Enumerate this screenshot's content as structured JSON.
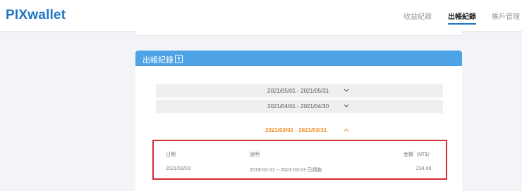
{
  "app": {
    "logo": "PIXwallet"
  },
  "nav": {
    "items": [
      {
        "label": "收益紀錄",
        "active": false
      },
      {
        "label": "出帳紀錄",
        "active": true
      },
      {
        "label": "帳戶管理",
        "active": false
      }
    ]
  },
  "panel": {
    "title": "出帳紀錄",
    "icon": "document-icon",
    "periods": [
      {
        "label": "2021/05/01 - 2021/05/31",
        "expanded": false
      },
      {
        "label": "2021/04/01 - 2021/04/30",
        "expanded": false
      }
    ],
    "active_period": {
      "label": "2021/03/01 - 2021/03/31",
      "expanded": true
    },
    "table": {
      "headers": {
        "date": "日期",
        "description": "說明",
        "amount": "金額（NT$）"
      },
      "rows": [
        {
          "date": "2021/03/23",
          "description": "2019-02-21 ~ 2021-03-23 已請款",
          "amount": "234.00"
        }
      ]
    }
  },
  "colors": {
    "brand": "#1f74c4",
    "panel_header": "#4ea3e6",
    "active_period": "#ef8b1a",
    "highlight_border": "#d52a30"
  }
}
